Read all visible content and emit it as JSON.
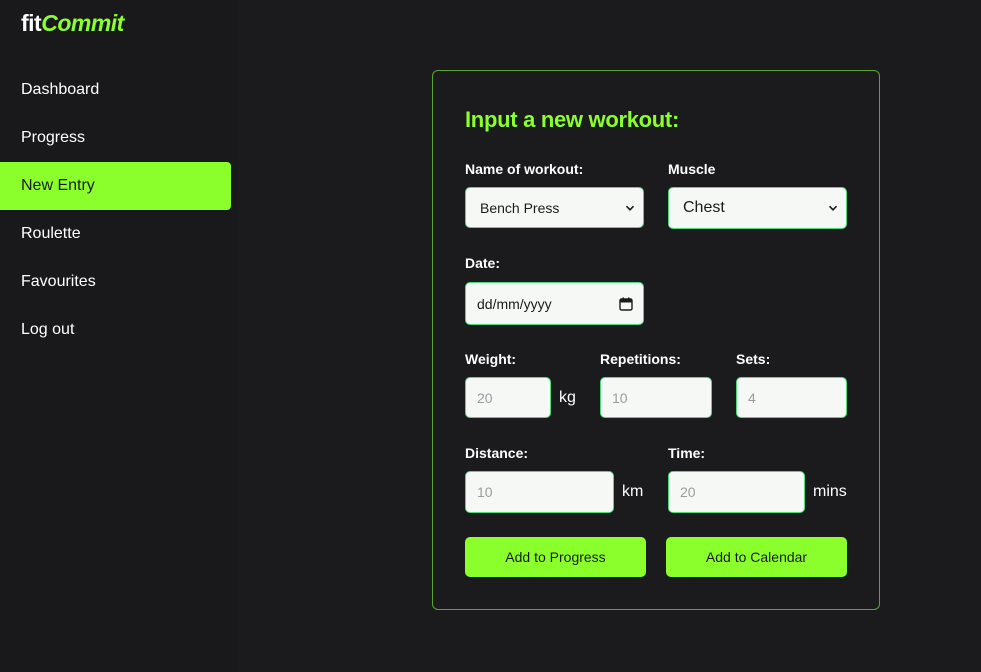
{
  "brand": {
    "fit": "fit",
    "commit": "Commit"
  },
  "nav": {
    "items": [
      {
        "label": "Dashboard"
      },
      {
        "label": "Progress"
      },
      {
        "label": "New Entry"
      },
      {
        "label": "Roulette"
      },
      {
        "label": "Favourites"
      },
      {
        "label": "Log out"
      }
    ],
    "active_index": 2
  },
  "form": {
    "title": "Input a new workout:",
    "workout": {
      "label": "Name of workout:",
      "value": "Bench Press"
    },
    "muscle": {
      "label": "Muscle",
      "value": "Chest"
    },
    "date": {
      "label": "Date:",
      "value": "dd/mm/yyyy"
    },
    "weight": {
      "label": "Weight:",
      "placeholder": "20",
      "unit": "kg"
    },
    "repetitions": {
      "label": "Repetitions:",
      "placeholder": "10"
    },
    "sets": {
      "label": "Sets:",
      "placeholder": "4"
    },
    "distance": {
      "label": "Distance:",
      "placeholder": "10",
      "unit": "km"
    },
    "time": {
      "label": "Time:",
      "placeholder": "20",
      "unit": "mins"
    },
    "buttons": {
      "progress": "Add to Progress",
      "calendar": "Add to Calendar"
    }
  },
  "colors": {
    "accent": "#8aff2b",
    "background": "#1b1b1d",
    "field_border": "#4fd97d"
  },
  "icons": {
    "select_chevron": "chevron-down-icon",
    "date_picker": "calendar-icon"
  }
}
